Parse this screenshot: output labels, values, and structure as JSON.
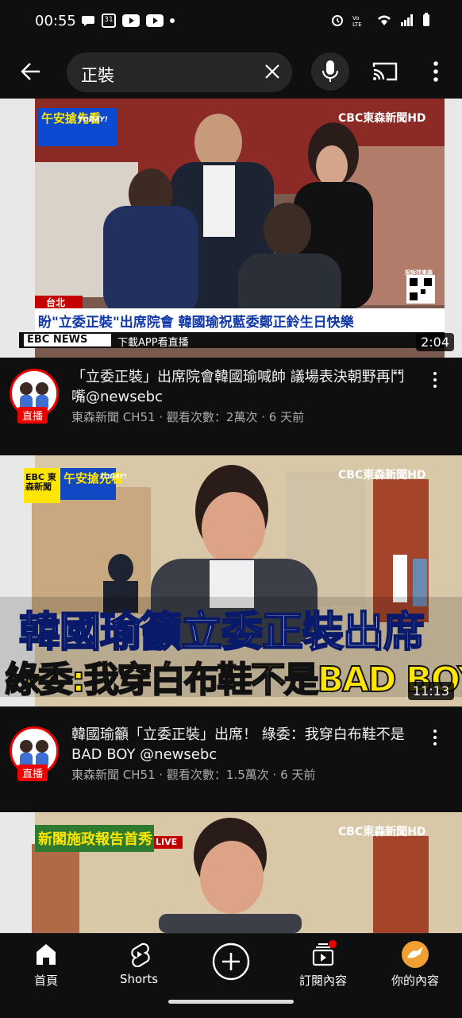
{
  "status": {
    "time": "00:55",
    "calendar_day": "31"
  },
  "search": {
    "query": "正裝"
  },
  "videos": [
    {
      "thumb_banner_top": "午安搶先看",
      "thumb_banner_today": "TODAY!",
      "thumb_brand": "CBC東森新聞HD",
      "thumb_location": "台北",
      "thumb_headline": "盼\"立委正裝\"出席院會 韓國瑜祝藍委鄭正鈴生日快樂",
      "thumb_ticker_brand": "EBC NEWS",
      "thumb_ticker": "下載APP看直播",
      "thumb_qr_label": "投訴找東森",
      "duration": "2:04",
      "title": "「立委正裝」出席院會韓國瑜喊帥 議場表決朝野再鬥嘴@newsebc",
      "channel_line": "東森新聞 CH51 · 觀看次數：2萬次 · 6 天前",
      "live_badge": "直播"
    },
    {
      "thumb_banner_top": "午安搶先看",
      "thumb_banner_today": "TODAY!",
      "thumb_logo": "EBC 東森新聞",
      "thumb_brand": "CBC東森新聞HD",
      "thumb_line1": "韓國瑜籲立委正裝出席",
      "thumb_line2": "綠委:我穿白布鞋不是BAD BOY",
      "duration": "11:13",
      "title": "韓國瑜籲「立委正裝」出席！ 綠委：我穿白布鞋不是BAD BOY @newsebc",
      "channel_line": "東森新聞 CH51 · 觀看次數：1.5萬次 · 6 天前",
      "live_badge": "直播"
    },
    {
      "thumb_banner_top": "新閣施政報告首秀",
      "thumb_live": "LIVE",
      "thumb_brand": "CBC東森新聞HD"
    }
  ],
  "nav": {
    "home": "首頁",
    "shorts": "Shorts",
    "subscriptions": "訂閱內容",
    "you": "你的內容"
  },
  "colors": {
    "accent_red": "#e00000",
    "background": "#0f0f0f",
    "ebc_yellow": "#ffe600"
  }
}
